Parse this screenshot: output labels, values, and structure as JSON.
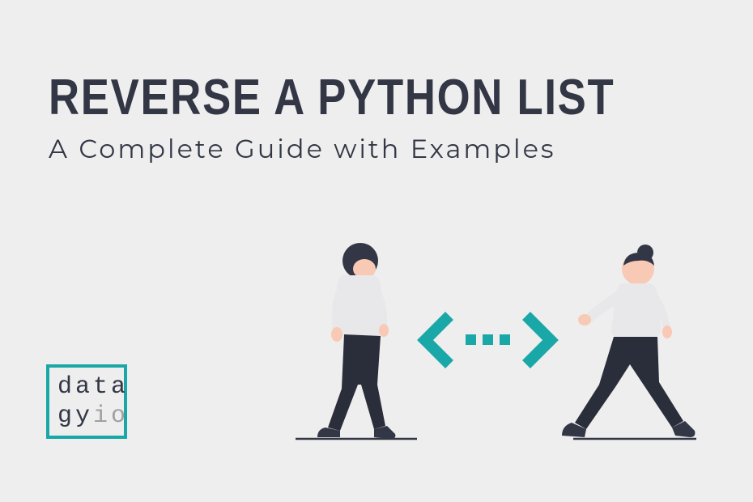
{
  "title": "Reverse a Python List",
  "subtitle": "A Complete Guide with Examples",
  "logo": {
    "line1": "data",
    "line2_a": "gy",
    "line2_b": "io"
  },
  "colors": {
    "accent": "#1aa7a7",
    "text": "#333745",
    "background": "#eeeeee",
    "muted": "#a0a0a0"
  },
  "illustration": {
    "description": "Two people facing each other with swap arrows between them"
  }
}
